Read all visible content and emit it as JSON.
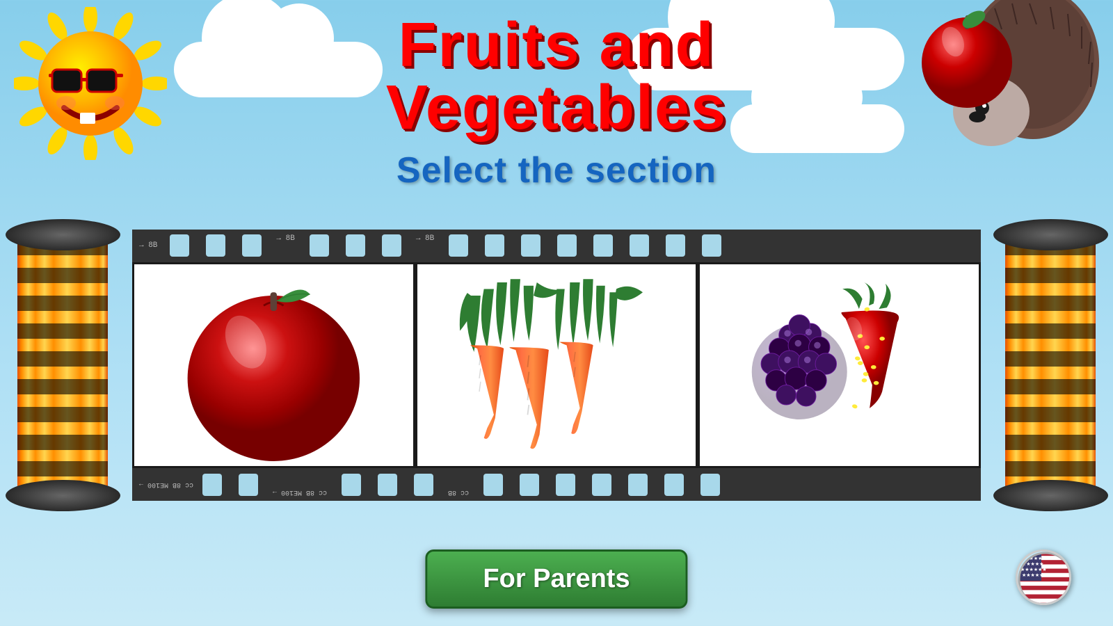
{
  "app": {
    "title": "Fruits and Vegetables",
    "subtitle": "Select the section"
  },
  "header": {
    "title_line1": "Fruits and",
    "title_line2": "Vegetables",
    "select_text": "Select the section"
  },
  "sections": [
    {
      "id": "fruits",
      "label": "Fruits",
      "image_desc": "Red apple with green leaf"
    },
    {
      "id": "vegetables",
      "label": "Vegetables",
      "image_desc": "Fresh carrots with green tops"
    },
    {
      "id": "berries",
      "label": "Berries",
      "image_desc": "Blackberry and strawberry"
    }
  ],
  "buttons": {
    "for_parents": "For Parents"
  },
  "language": {
    "current": "English",
    "flag": "US"
  },
  "film": {
    "label_top": "→  8B  ←←←←←←←  →  8B  ←←←←←←←  →  8B  ←←←←←←←",
    "label_bottom": "cc  8B  ME100  →  cc  8B  ME100  →  cc  8B"
  },
  "colors": {
    "title_red": "#FF0000",
    "subtitle_blue": "#1565C0",
    "sky_top": "#87CEEB",
    "btn_green": "#4CAF50",
    "reel_orange": "#FFB300",
    "film_dark": "#2a2a2a"
  }
}
